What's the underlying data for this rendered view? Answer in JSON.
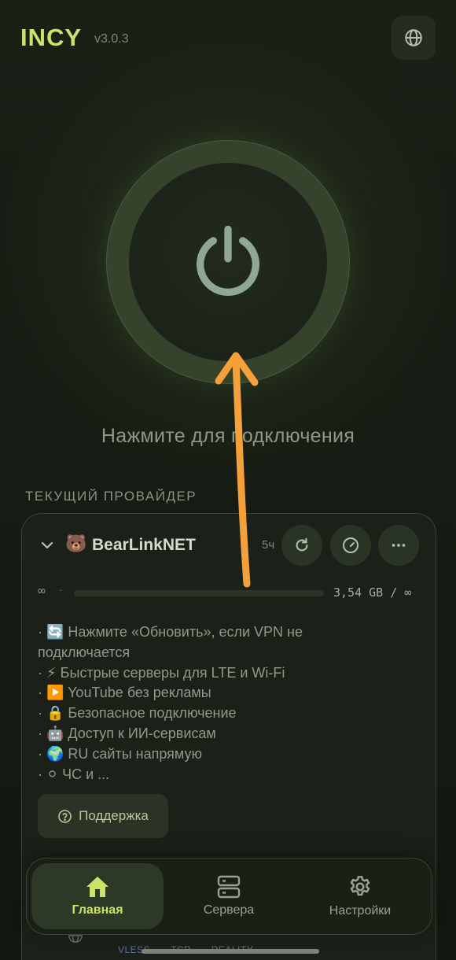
{
  "header": {
    "app_name": "INCY",
    "version": "v3.0.3",
    "language_icon": "globe-icon"
  },
  "power": {
    "icon": "power-icon",
    "hint": "Нажмите для подключения"
  },
  "provider_section": {
    "label": "ТЕКУЩИЙ ПРОВАЙДЕР",
    "provider": {
      "emoji": "🐻",
      "name": "BearLinkNET",
      "updated": "5ч"
    },
    "actions": [
      {
        "icon": "refresh-icon"
      },
      {
        "icon": "speedometer-icon"
      },
      {
        "icon": "more-icon"
      }
    ],
    "traffic": {
      "limit_symbol": "∞",
      "separator": "·",
      "used": "3,54 GB / ∞",
      "progress_percent": 0
    },
    "description": [
      "· 🔄 Нажмите «Обновить», если VPN не",
      "подключается",
      "· ⚡ Быстрые серверы для LTE и Wi-Fi",
      "· ▶️ YouTube без рекламы",
      "· 🔒 Безопасное подключение",
      "· 🤖 Доступ к ИИ-сервисам",
      "· 🌍 RU сайты напрямую",
      "· ⚪ ЧС и ..."
    ],
    "support_label": "Поддержка",
    "peek_server": {
      "protocols": [
        "VLESS",
        "TCP",
        "REALITY"
      ]
    }
  },
  "nav": {
    "items": [
      {
        "label": "Главная",
        "icon": "home-icon",
        "active": true
      },
      {
        "label": "Сервера",
        "icon": "server-icon",
        "active": false
      },
      {
        "label": "Настройки",
        "icon": "gear-icon",
        "active": false
      }
    ]
  },
  "colors": {
    "accent": "#c9e36b",
    "background": "#151a12",
    "annotation": "#f5a03a"
  }
}
